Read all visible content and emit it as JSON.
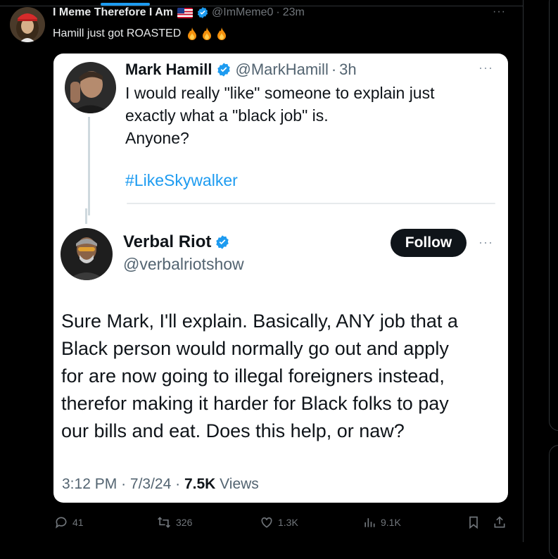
{
  "post": {
    "author_name": "I Meme Therefore I Am",
    "author_handle": "@ImMeme0",
    "time": "23m",
    "text": "Hamill just got ROASTED",
    "more": "···"
  },
  "quoted_tweet": {
    "name": "Mark Hamill",
    "handle": "@MarkHamill",
    "time": "3h",
    "text": "I would really \"like\" someone to explain just\nexactly what a \"black job\" is.\nAnyone?",
    "hashtag": "#LikeSkywalker",
    "more": "···"
  },
  "reply_tweet": {
    "name": "Verbal Riot",
    "handle": "@verbalriotshow",
    "follow_label": "Follow",
    "text": "Sure Mark, I'll explain. Basically, ANY job that a\nBlack person would normally go out and apply\nfor are now going to illegal foreigners instead,\ntherefor making it harder for Black folks to pay\nour bills and eat. Does this help, or naw?",
    "time": "3:12 PM",
    "date": "7/3/24",
    "views_count": "7.5K",
    "views_label": "Views",
    "more": "···"
  },
  "actions": {
    "replies": "41",
    "reposts": "326",
    "likes": "1.3K",
    "views": "9.1K"
  },
  "icons": [
    "verified-badge-icon",
    "us-flag-icon",
    "fire-icon",
    "reply-icon",
    "repost-icon",
    "like-icon",
    "views-icon",
    "bookmark-icon",
    "share-icon"
  ],
  "colors": {
    "accent": "#1d9bf0",
    "muted": "#71767b",
    "background": "#000000"
  }
}
